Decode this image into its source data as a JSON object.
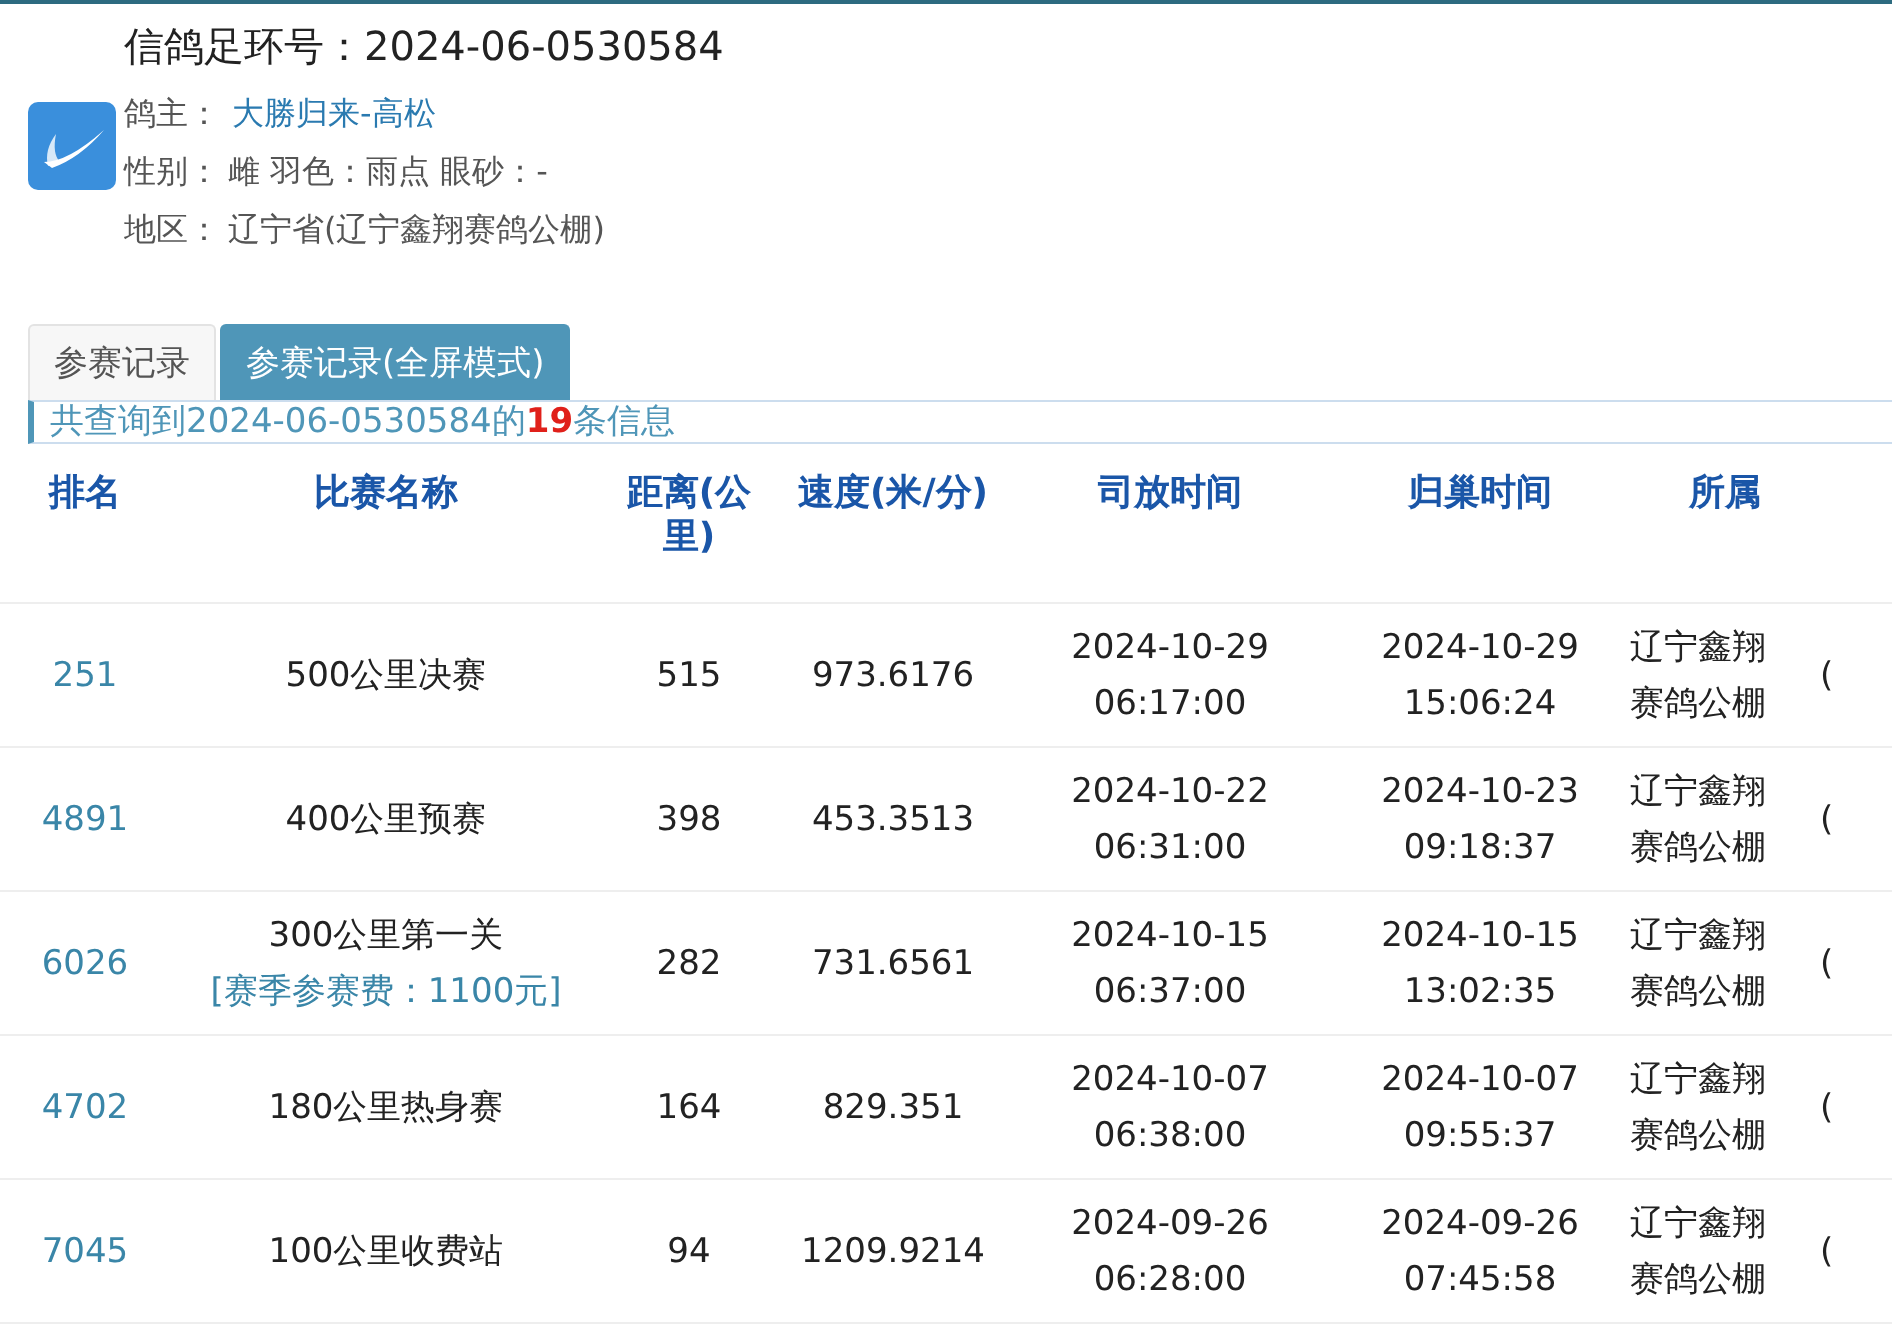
{
  "header": {
    "ring_label": "信鸽足环号：",
    "ring_number": "2024-06-0530584",
    "fields": [
      {
        "label": "鸽主：",
        "value": "大勝归来-高松",
        "kind": "link"
      },
      {
        "label": "性别：",
        "value": "雌 羽色：雨点 眼砂：-",
        "kind": "text"
      },
      {
        "label": "地区：",
        "value": "辽宁省(辽宁鑫翔赛鸽公棚)",
        "kind": "text"
      }
    ]
  },
  "tabs": [
    {
      "label": "参赛记录",
      "selected": false
    },
    {
      "label": "参赛记录(全屏模式)",
      "selected": true
    }
  ],
  "summary": "共查询到2024-06-0530584的**19**条信息",
  "table": {
    "columns": [
      "排名",
      "比赛名称",
      "距离(公里)",
      "速度(米/分)",
      "司放时间",
      "归巢时间",
      "所属"
    ],
    "rows": [
      {
        "rank": "251",
        "race": "500公里决赛",
        "distance": "515",
        "speed": "973.6176",
        "release": "2024-10-29 06:17:00",
        "return": "2024-10-29 15:06:24",
        "club": "辽宁鑫翔赛鸽公棚",
        "column_8": "("
      },
      {
        "rank": "4891",
        "race": "400公里预赛",
        "distance": "398",
        "speed": "453.3513",
        "release": "2024-10-22 06:31:00",
        "return": "2024-10-23 09:18:37",
        "club": "辽宁鑫翔赛鸽公棚",
        "column_8": "("
      },
      {
        "rank": "6026",
        "race": "300公里第一关",
        "fee_link": "[赛季参赛费：1100元]",
        "distance": "282",
        "speed": "731.6561",
        "release": "2024-10-15 06:37:00",
        "return": "2024-10-15 13:02:35",
        "club": "辽宁鑫翔赛鸽公棚",
        "column_8": "("
      },
      {
        "rank": "4702",
        "race": "180公里热身赛",
        "distance": "164",
        "speed": "829.351",
        "release": "2024-10-07 06:38:00",
        "return": "2024-10-07 09:55:37",
        "club": "辽宁鑫翔赛鸽公棚",
        "column_8": "("
      },
      {
        "rank": "7045",
        "race": "100公里收费站",
        "distance": "94",
        "speed": "1209.9214",
        "release": "2024-09-26 06:28:00",
        "return": "2024-09-26 07:45:58",
        "club": "辽宁鑫翔赛鸽公棚",
        "column_8": "("
      }
    ]
  }
}
